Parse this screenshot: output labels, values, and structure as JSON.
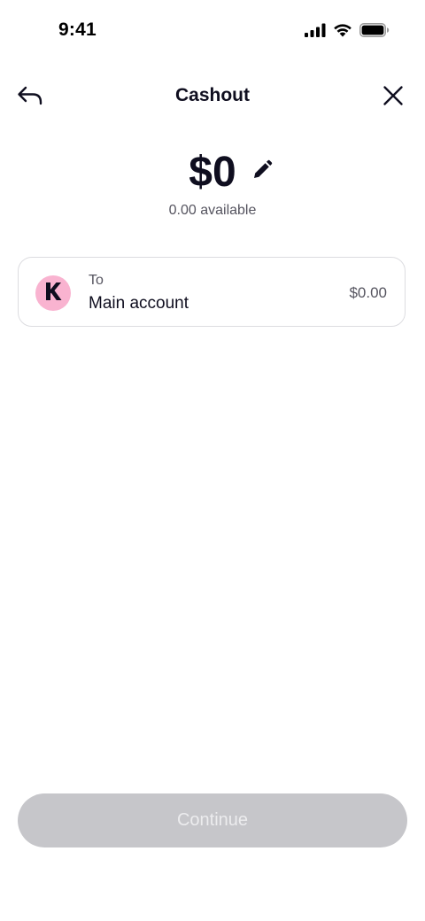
{
  "status_bar": {
    "time": "9:41",
    "icons": [
      "cellular-signal-icon",
      "wifi-icon",
      "battery-icon"
    ]
  },
  "header": {
    "title": "Cashout",
    "back_icon": "back-arrow-icon",
    "close_icon": "close-icon"
  },
  "amount": {
    "value": "$0",
    "edit_icon": "pencil-icon",
    "available": "0.00 available"
  },
  "destination": {
    "label": "To",
    "account_name": "Main account",
    "balance": "$0.00",
    "avatar_letter": "K",
    "avatar_color": "#f9b3d0"
  },
  "footer": {
    "continue_label": "Continue",
    "continue_enabled": false,
    "button_color": "#c6c6ca"
  },
  "colors": {
    "text_primary": "#0f0e1f",
    "text_secondary": "#55545f",
    "card_border": "#dcdce0"
  }
}
